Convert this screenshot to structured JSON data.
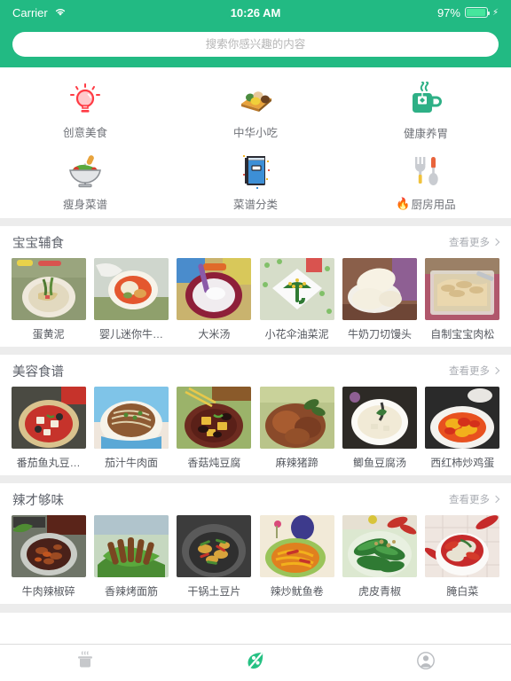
{
  "statusbar": {
    "carrier": "Carrier",
    "wifi_icon": "wifi-icon",
    "time": "10:26 AM",
    "battery_percent": "97%",
    "battery_icon": "battery-icon",
    "charging_icon": "lightning-bolt-icon"
  },
  "header": {
    "accent_color": "#22ba83",
    "search": {
      "placeholder": "搜索你感兴趣的内容",
      "value": ""
    }
  },
  "categories": [
    {
      "label": "创意美食",
      "icon": "lightbulb-icon",
      "color": "#ff3b44"
    },
    {
      "label": "中华小吃",
      "icon": "dumpling-plate-icon",
      "color": "#d79a3a"
    },
    {
      "label": "健康养胃",
      "icon": "tea-mug-icon",
      "color": "#2eb086"
    },
    {
      "label": "瘦身菜谱",
      "icon": "salad-bowl-icon",
      "color": "#9aa0a6"
    },
    {
      "label": "菜谱分类",
      "icon": "recipe-book-icon",
      "color": "#3d8fd6"
    },
    {
      "label": "厨房用品",
      "icon": "fork-spoon-icon",
      "color": "#c9ccd1",
      "prefix_emoji": "🔥"
    }
  ],
  "sections": [
    {
      "title": "宝宝辅食",
      "more_label": "查看更多",
      "more_icon": "chevron-right-icon",
      "items": [
        {
          "label": "蛋黄泥",
          "thumb": "egg-yolk-paste-photo",
          "c1": "#8e9a73",
          "c2": "#e8e0cf",
          "c3": "#d8c48a"
        },
        {
          "label": "婴儿迷你牛…",
          "thumb": "baby-mini-beef-photo",
          "c1": "#cfd6cd",
          "c2": "#f3eee2",
          "c3": "#e0a24f"
        },
        {
          "label": "大米汤",
          "thumb": "rice-soup-photo",
          "c1": "#c9b36e",
          "c2": "#8e1f39",
          "c3": "#f0ecef"
        },
        {
          "label": "小花伞油菜泥",
          "thumb": "veg-umbrella-puree-photo",
          "c1": "#d6ddc9",
          "c2": "#f7f7f3",
          "c3": "#2f7a33"
        },
        {
          "label": "牛奶刀切馒头",
          "thumb": "milk-mantou-photo",
          "c1": "#8a5f4a",
          "c2": "#f4eddc",
          "c3": "#8e5f93"
        },
        {
          "label": "自制宝宝肉松",
          "thumb": "homemade-pork-floss-photo",
          "c1": "#9b8066",
          "c2": "#ead7ae",
          "c3": "#b0576c"
        }
      ]
    },
    {
      "title": "美容食谱",
      "more_label": "查看更多",
      "more_icon": "chevron-right-icon",
      "items": [
        {
          "label": "番茄鱼丸豆…",
          "thumb": "tomato-fishball-tofu-photo",
          "c1": "#4a4a42",
          "c2": "#d9c38e",
          "c3": "#c6332b"
        },
        {
          "label": "茄汁牛肉面",
          "thumb": "tomato-beef-noodle-photo",
          "c1": "#7fc4e8",
          "c2": "#f2ece0",
          "c3": "#8e5a33"
        },
        {
          "label": "香菇炖豆腐",
          "thumb": "mushroom-tofu-photo",
          "c1": "#9bb36a",
          "c2": "#6d2b20",
          "c3": "#e8bb3a"
        },
        {
          "label": "麻辣猪蹄",
          "thumb": "spicy-pig-trotter-photo",
          "c1": "#b9c48a",
          "c2": "#8a4a2a",
          "c3": "#3f6b2c"
        },
        {
          "label": "鲫鱼豆腐汤",
          "thumb": "crucian-tofu-soup-photo",
          "c1": "#2d2a26",
          "c2": "#f1ead6",
          "c3": "#3a7a3a"
        },
        {
          "label": "西红柿炒鸡蛋",
          "thumb": "tomato-egg-photo",
          "c1": "#2a2a2a",
          "c2": "#f4f2ee",
          "c3": "#e8511f"
        }
      ]
    },
    {
      "title": "辣才够味",
      "more_label": "查看更多",
      "more_icon": "chevron-right-icon",
      "items": [
        {
          "label": "牛肉辣椒碎",
          "thumb": "beef-chili-mince-photo",
          "c1": "#6f7568",
          "c2": "#4a2119",
          "c3": "#9c4a22"
        },
        {
          "label": "香辣烤面筋",
          "thumb": "spicy-gluten-photo",
          "c1": "#c6d8c0",
          "c2": "#7a4622",
          "c3": "#4a8c33"
        },
        {
          "label": "干锅土豆片",
          "thumb": "dry-pot-potato-photo",
          "c1": "#3c3c3c",
          "c2": "#d8a43c",
          "c3": "#4a8c33"
        },
        {
          "label": "辣炒鱿鱼卷",
          "thumb": "spicy-squid-roll-photo",
          "c1": "#f2ead8",
          "c2": "#e0801f",
          "c3": "#3d3a8c"
        },
        {
          "label": "虎皮青椒",
          "thumb": "tiger-skin-pepper-photo",
          "c1": "#dce8d0",
          "c2": "#2f7a33",
          "c3": "#b8c45a"
        },
        {
          "label": "腌白菜",
          "thumb": "pickled-cabbage-photo",
          "c1": "#efe6e0",
          "c2": "#c62a2a",
          "c3": "#e8e2d2"
        }
      ]
    }
  ],
  "tabbar": {
    "tabs": [
      {
        "name": "pot-tab",
        "icon": "cooking-pot-icon",
        "active": false,
        "color": "#c6c8cb"
      },
      {
        "name": "leaf-tab",
        "icon": "leaf-icon",
        "active": true,
        "color": "#25c183"
      },
      {
        "name": "profile-tab",
        "icon": "person-icon",
        "active": false,
        "color": "#b9bcc0"
      }
    ]
  }
}
